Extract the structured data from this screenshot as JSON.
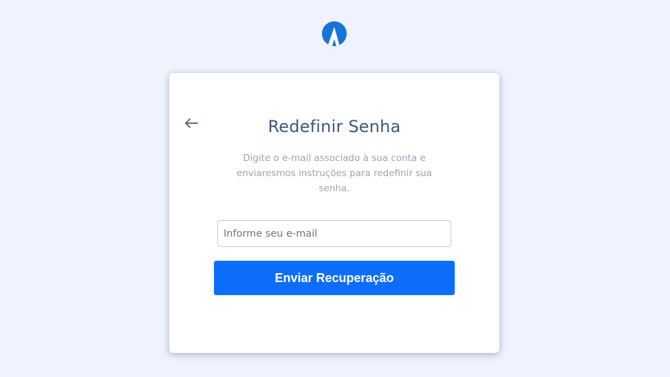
{
  "brand": {
    "logo_icon": "triangle-a-logo-icon",
    "color": "#1a73d9"
  },
  "card": {
    "back_icon": "arrow-left-icon",
    "title": "Redefinir Senha",
    "description": "Digite o e-mail associado à sua conta e enviaresmos instruções para redefinir sua senha.",
    "email_field": {
      "placeholder": "Informe seu e-mail",
      "value": ""
    },
    "submit_label": "Enviar Recuperação",
    "accent_color": "#0d6efd"
  }
}
